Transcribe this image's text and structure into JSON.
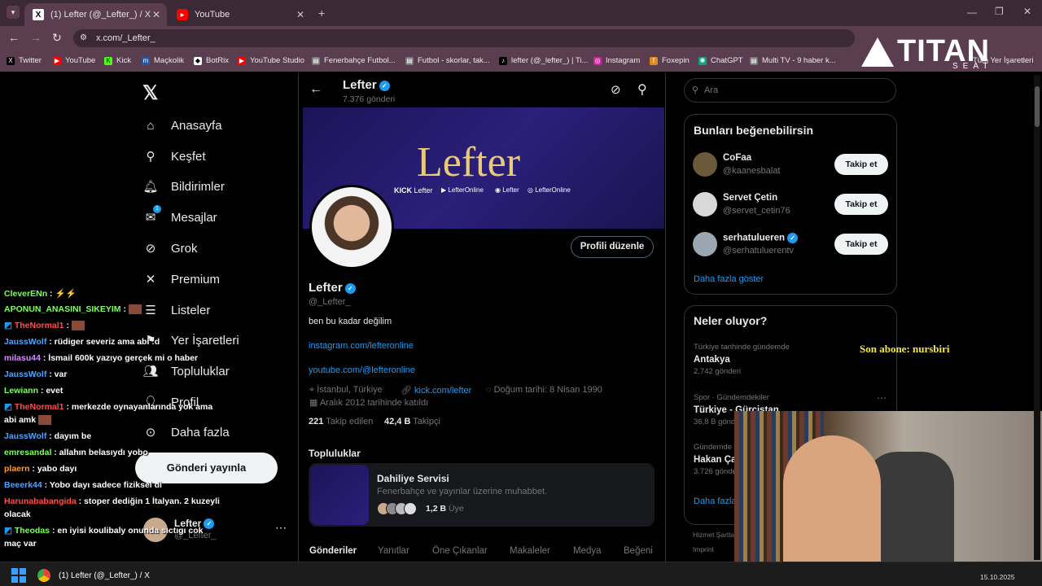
{
  "browser": {
    "tabs": [
      {
        "title": "(1) Lefter (@_Lefter_) / X",
        "active": true
      },
      {
        "title": "YouTube",
        "active": false
      }
    ],
    "url": "x.com/_Lefter_",
    "bookmarks": [
      "Twitter",
      "YouTube",
      "Kick",
      "Maçkolik",
      "BotRix",
      "YouTube Studio",
      "Fenerbahçe Futbol...",
      "Futbol - skorlar, tak...",
      "lefter (@_lefter_) | Ti...",
      "Instagram",
      "Foxepin",
      "ChatGPT",
      "Multi TV - 9 haber k...",
      "Tüm Yer İşaretleri"
    ]
  },
  "overlay": {
    "logo": "TITAN",
    "logo_sub": "SEAT",
    "last_sub": "Son abone: nursbiri"
  },
  "nav": {
    "items": [
      "Anasayfa",
      "Keşfet",
      "Bildirimler",
      "Mesajlar",
      "Grok",
      "Premium",
      "Listeler",
      "Yer İşaretleri",
      "Topluluklar",
      "Profil",
      "Daha fazla"
    ],
    "post_label": "Gönderi yayınla",
    "account_name": "Lefter",
    "account_handle": "@_Lefter_",
    "messages_badge": "1"
  },
  "profile": {
    "header_name": "Lefter",
    "post_count": "7.376 gönderi",
    "banner_title": "Lefter",
    "banner_links": [
      "Lefter",
      "LefterOnline",
      "Lefter",
      "LefterOnline"
    ],
    "edit_label": "Profili düzenle",
    "name": "Lefter",
    "handle": "@_Lefter_",
    "bio": "ben bu kadar değilim",
    "link1": "instagram.com/lefteronline",
    "link2": "youtube.com/@lefteronline",
    "location": "İstanbul, Türkiye",
    "website": "kick.com/lefter",
    "birth": "Doğum tarihi: 8 Nisan 1990",
    "joined": "Aralık 2012 tarihinde katıldı",
    "following_count": "221",
    "following_label": "Takip edilen",
    "followers_count": "42,4 B",
    "followers_label": "Takipçi",
    "communities_title": "Topluluklar",
    "community_name": "Dahiliye Servisi",
    "community_desc": "Fenerbahçe ve yayınlar üzerine muhabbet.",
    "community_members": "1,2 B",
    "community_members_label": "Üye",
    "tabs": [
      "Gönderiler",
      "Yanıtlar",
      "Öne Çıkanlar",
      "Makaleler",
      "Medya",
      "Beğeni"
    ]
  },
  "sidebar": {
    "search_placeholder": "Ara",
    "suggest_title": "Bunları beğenebilirsin",
    "suggestions": [
      {
        "name": "CoFaa",
        "handle": "@kaanesbalat",
        "verified": false
      },
      {
        "name": "Servet Çetin",
        "handle": "@servet_cetin76",
        "verified": false
      },
      {
        "name": "serhatulueren",
        "handle": "@serhatuluerentv",
        "verified": true
      }
    ],
    "follow_label": "Takip et",
    "show_more": "Daha fazla göster",
    "trends_title": "Neler oluyor?",
    "trends": [
      {
        "context": "Türkiye tarihinde gündemde",
        "name": "Antakya",
        "count": "2.742 gönderi"
      },
      {
        "context": "Spor · Gündemdekiler",
        "name": "Türkiye - Gürcistan",
        "count": "36,8 B gönderi"
      },
      {
        "context": "Gündemde",
        "name": "Hakan Ça",
        "count": "3.726 gönderi"
      }
    ],
    "trends_more": "Daha fazla",
    "footer1": "Hizmet Şartları",
    "footer2": "Imprint"
  },
  "chat": [
    {
      "user": "CleverENn",
      "color": "#7bff5a",
      "msg": " : "
    },
    {
      "user": "APONUN_ANASINI_SIKEYIM",
      "color": "#7bff5a",
      "msg": " : "
    },
    {
      "user": "TheNormal1",
      "color": "#ff4d4d",
      "msg": " : "
    },
    {
      "user": "JaussWolf",
      "color": "#4da3ff",
      "msg": " : rüdiger severiz ama abi :d"
    },
    {
      "user": "milasu44",
      "color": "#d58cff",
      "msg": " : İsmail 600k yazıyo gerçek mi o haber"
    },
    {
      "user": "JaussWolf",
      "color": "#4da3ff",
      "msg": " : var"
    },
    {
      "user": "Lewiann",
      "color": "#7bff5a",
      "msg": " : evet"
    },
    {
      "user": "TheNormal1",
      "color": "#ff4d4d",
      "msg": " : merkezde oynayanlarında yok ama"
    },
    {
      "user": "",
      "color": "#ffffff",
      "msg": "abi amk"
    },
    {
      "user": "JaussWolf",
      "color": "#4da3ff",
      "msg": " : dayım be"
    },
    {
      "user": "emresandal",
      "color": "#7bff5a",
      "msg": " : allahın belasıydı yobo"
    },
    {
      "user": "plaern",
      "color": "#ff9a3c",
      "msg": " : yabo dayı"
    },
    {
      "user": "Beeerk44",
      "color": "#4da3ff",
      "msg": " : Yobo dayı sadece fiziksel di"
    },
    {
      "user": "Harunababangida",
      "color": "#ff4d4d",
      "msg": " : stoper dediğin 1 İtalyan. 2 kuzeyli"
    },
    {
      "user": "",
      "color": "#ffffff",
      "msg": "olacak"
    },
    {
      "user": "Theodas",
      "color": "#7bff5a",
      "msg": " : en iyisi koulibaly onunda sıctıgı cok"
    },
    {
      "user": "",
      "color": "#ffffff",
      "msg": "maç var"
    }
  ],
  "taskbar": {
    "app_title": "(1) Lefter (@_Lefter_) / X",
    "date": "15.10.2025"
  }
}
